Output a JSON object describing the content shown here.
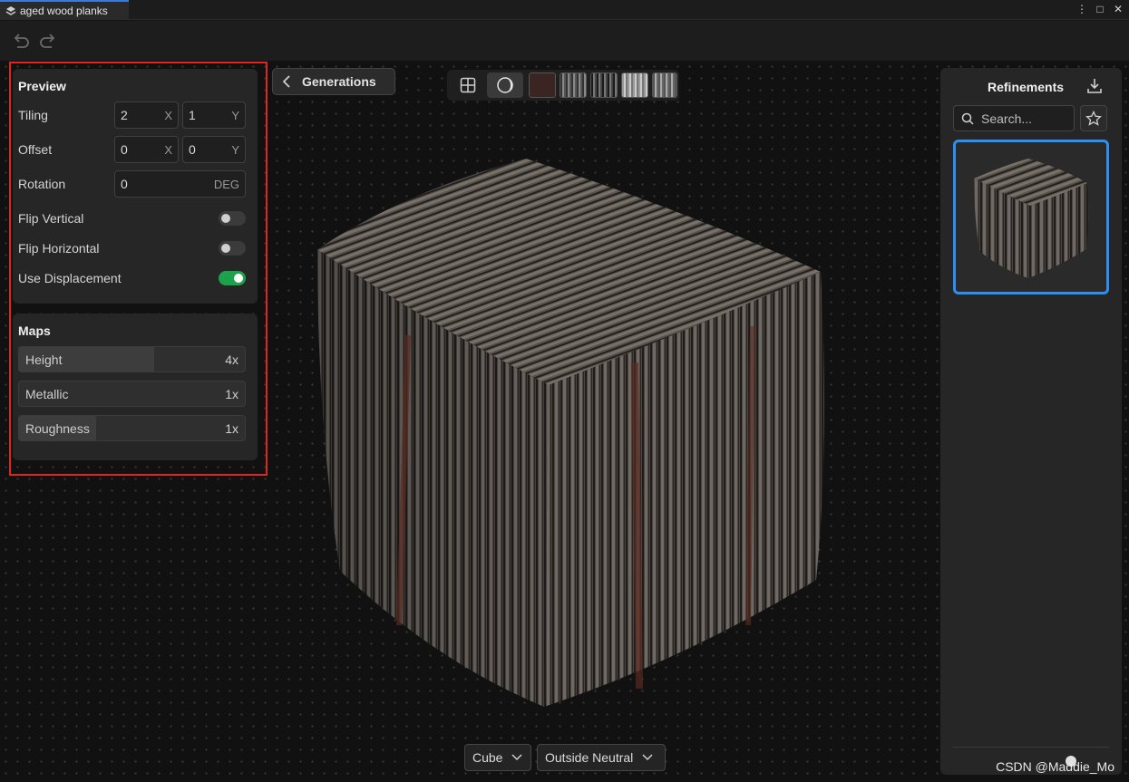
{
  "window": {
    "tab_title": "aged wood planks",
    "controls": [
      "⋮",
      "□",
      "✕"
    ]
  },
  "toolbar": {
    "undo_icon": "undo-icon",
    "redo_icon": "redo-icon"
  },
  "preview": {
    "title": "Preview",
    "tiling": {
      "label": "Tiling",
      "x": "2",
      "x_unit": "X",
      "y": "1",
      "y_unit": "Y"
    },
    "offset": {
      "label": "Offset",
      "x": "0",
      "x_unit": "X",
      "y": "0",
      "y_unit": "Y"
    },
    "rotation": {
      "label": "Rotation",
      "value": "0",
      "unit": "DEG"
    },
    "flip_vertical": {
      "label": "Flip Vertical",
      "on": false
    },
    "flip_horizontal": {
      "label": "Flip Horizontal",
      "on": false
    },
    "use_displacement": {
      "label": "Use Displacement",
      "on": true
    }
  },
  "maps": {
    "title": "Maps",
    "items": [
      {
        "name": "Height",
        "multiplier": "4x",
        "fill": 0.6
      },
      {
        "name": "Metallic",
        "multiplier": "1x",
        "fill": 0.0
      },
      {
        "name": "Roughness",
        "multiplier": "1x",
        "fill": 0.34
      }
    ]
  },
  "generations_button": "Generations",
  "view_bar": {
    "modes": [
      "grid-view-icon",
      "sphere-view-icon"
    ],
    "swatches": [
      "#3a2522",
      "#6a6a6a",
      "#4a4a4a",
      "#8a8a8a",
      "#7a7a7a"
    ]
  },
  "refinements": {
    "title": "Refinements",
    "search_placeholder": "Search...",
    "download_icon": "download-icon",
    "favorite_icon": "star-icon"
  },
  "bottom": {
    "shape": "Cube",
    "environment": "Outside Neutral"
  },
  "watermark": "CSDN @Maddie_Mo"
}
